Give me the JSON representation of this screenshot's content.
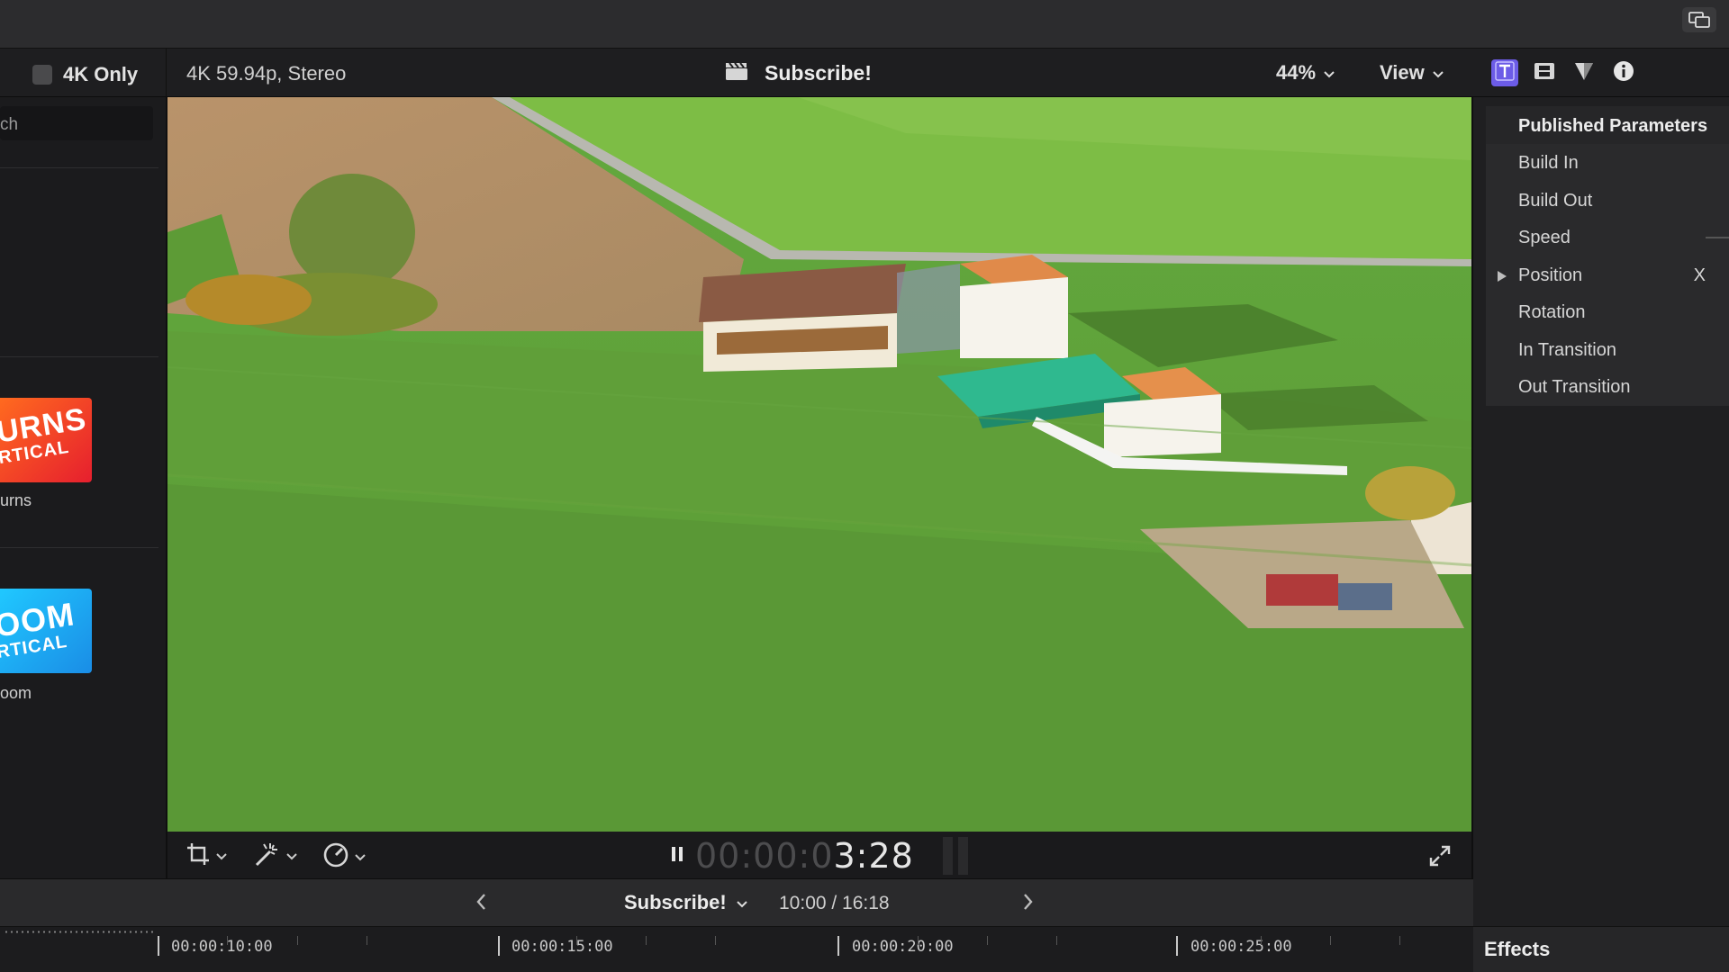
{
  "toolbar": {
    "only4k_label": "4K Only",
    "format": "4K 59.94p, Stereo",
    "project_title": "Subscribe!",
    "zoom": "44%",
    "view_label": "View"
  },
  "browser": {
    "search_text": "ch",
    "items": [
      {
        "thumb_line1": "URNS",
        "thumb_line2": "RTICAL",
        "label": "urns",
        "thumb_colors": [
          "#ff5a1f",
          "#e8202a"
        ]
      },
      {
        "thumb_line1": "OOM",
        "thumb_line2": "RTICAL",
        "label": "oom",
        "thumb_colors": [
          "#19c4ff",
          "#1b8fe8"
        ]
      }
    ]
  },
  "transport": {
    "timecode_dim": "00:00:0",
    "timecode_bright": "3:28"
  },
  "inspector": {
    "header": "Published Parameters",
    "params": [
      "Build In",
      "Build Out",
      "Speed",
      "Position",
      "Rotation",
      "In Transition",
      "Out Transition"
    ],
    "position_suffix": "X"
  },
  "timeline": {
    "title": "Subscribe!",
    "time": "10:00 / 16:18",
    "ruler_labels": [
      "00:00:10:00",
      "00:00:15:00",
      "00:00:20:00",
      "00:00:25:00"
    ]
  },
  "effects_label": "Effects",
  "colors": {
    "accent": "#6c5ce7",
    "grass": "#5b9a3a"
  }
}
